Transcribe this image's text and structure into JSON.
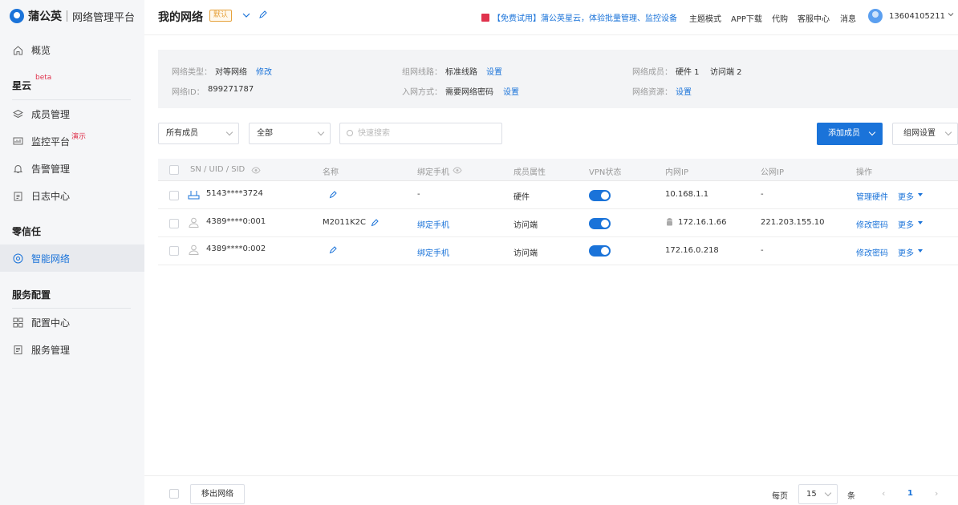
{
  "brand": {
    "name": "蒲公英",
    "subtitle": "网络管理平台"
  },
  "sidebar": {
    "overview": "概览",
    "section_star": "星云",
    "star_sup": "beta",
    "members": "成员管理",
    "monitor": "监控平台",
    "monitor_sup": "演示",
    "alerts": "告警管理",
    "logs": "日志中心",
    "section_zero": "零信任",
    "smart": "智能网络",
    "section_service": "服务配置",
    "config": "配置中心",
    "service": "服务管理"
  },
  "topbar": {
    "title": "我的网络",
    "badge": "默认",
    "promo": "【免费试用】蒲公英星云，体验批量管理、监控设备",
    "theme": "主题模式",
    "app": "APP下载",
    "agent": "代购",
    "support": "客服中心",
    "messages": "消息",
    "user": "13604105211"
  },
  "info": {
    "type_label": "网络类型：",
    "type_value": "对等网络",
    "type_action": "修改",
    "id_label": "网络ID：",
    "id_value": "899271787",
    "route_label": "组网线路：",
    "route_value": "标准线路",
    "route_action": "设置",
    "join_label": "入网方式：",
    "join_value": "需要网络密码",
    "join_action": "设置",
    "members_label": "网络成员：",
    "members_hw": "硬件 1",
    "members_vis": "访问端 2",
    "res_label": "网络资源：",
    "res_action": "设置"
  },
  "filters": {
    "member_filter": "所有成员",
    "status_filter": "全部",
    "search_placeholder": "快速搜索",
    "add_button": "添加成员",
    "settings_button": "组网设置"
  },
  "table": {
    "headers": [
      "SN / UID / SID",
      "名称",
      "绑定手机",
      "成员属性",
      "VPN状态",
      "内网IP",
      "公网IP",
      "操作"
    ],
    "rows": [
      {
        "id": "5143****3724",
        "name": "",
        "phone": "-",
        "type": "硬件",
        "vpn": true,
        "lan": "10.168.1.1",
        "wan": "-",
        "action": "管理硬件",
        "more": "更多"
      },
      {
        "id": "4389****0:001",
        "name": "M2011K2C",
        "phone": "绑定手机",
        "type": "访问端",
        "vpn": true,
        "lan": "172.16.1.66",
        "wan": "221.203.155.10",
        "action": "修改密码",
        "more": "更多"
      },
      {
        "id": "4389****0:002",
        "name": "",
        "phone": "绑定手机",
        "type": "访问端",
        "vpn": true,
        "lan": "172.16.0.218",
        "wan": "-",
        "action": "修改密码",
        "more": "更多"
      }
    ]
  },
  "footer": {
    "exit_button": "移出网络",
    "per_page_label": "每页",
    "per_page_value": "15",
    "unit": "条",
    "current_page": "1",
    "prev": "‹",
    "next": "›"
  }
}
